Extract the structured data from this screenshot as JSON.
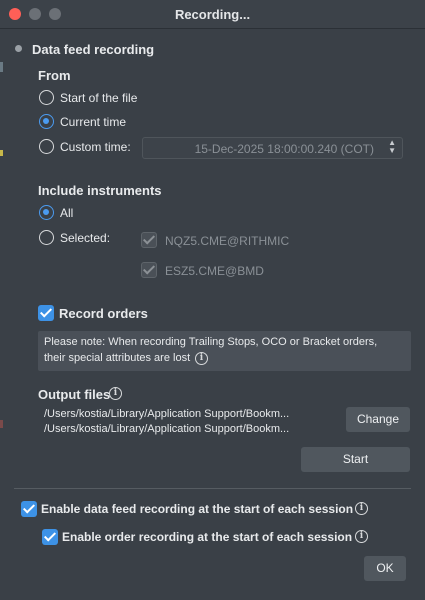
{
  "window": {
    "title": "Recording..."
  },
  "section": {
    "heading": "Data feed recording"
  },
  "from": {
    "label": "From",
    "options": [
      "Start of the file",
      "Current time",
      "Custom time:"
    ],
    "selected": "Current time",
    "custom_time_value": "15-Dec-2025 18:00:00.240 (COT)"
  },
  "instruments": {
    "label": "Include instruments",
    "options": [
      "All",
      "Selected:"
    ],
    "selected": "All",
    "items": [
      "NQZ5.CME@RITHMIC",
      "ESZ5.CME@BMD"
    ]
  },
  "record_orders": {
    "label": "Record orders",
    "checked": true,
    "note_line1": "Please note: When recording Trailing Stops, OCO or Bracket orders,",
    "note_line2": "their special attributes are lost"
  },
  "output_files": {
    "label": "Output files",
    "paths": [
      "/Users/kostia/Library/Application Support/Bookm...",
      "/Users/kostia/Library/Application Support/Bookm..."
    ],
    "change_label": "Change",
    "start_label": "Start"
  },
  "session": {
    "enable_data_feed_label": "Enable data feed recording at the start of each session",
    "enable_order_label": "Enable order recording at the start of each session"
  },
  "ok_label": "OK",
  "colors": {
    "accent": "#3d92e6",
    "background": "#3a4047",
    "button": "#50575e"
  }
}
